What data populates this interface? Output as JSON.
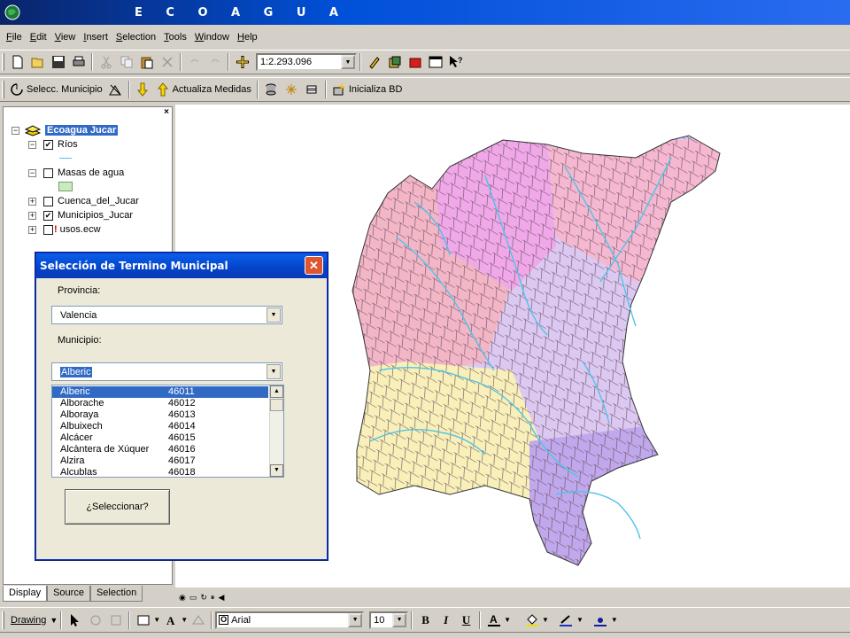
{
  "app": {
    "title": "E C O A G U A"
  },
  "menu": [
    "File",
    "Edit",
    "View",
    "Insert",
    "Selection",
    "Tools",
    "Window",
    "Help"
  ],
  "toolbar": {
    "scale": "1:2.293.096"
  },
  "toolbar2": {
    "select_municipio": "Selecc. Municipio",
    "actualiza_medidas": "Actualiza Medidas",
    "inicializa_bd": "Inicializa BD"
  },
  "toc": {
    "root": "Ecoagua Jucar",
    "layers": [
      {
        "name": "Ríos",
        "checked": true,
        "expanded": true
      },
      {
        "name": "Masas de agua",
        "checked": false,
        "expanded": true
      },
      {
        "name": "Cuenca_del_Jucar",
        "checked": false,
        "expanded": false
      },
      {
        "name": "Municipios_Jucar",
        "checked": true,
        "expanded": false
      },
      {
        "name": "usos.ecw",
        "checked": false,
        "expanded": false,
        "warning": "!"
      }
    ],
    "tabs": [
      "Display",
      "Source",
      "Selection"
    ]
  },
  "dialog": {
    "title": "Selección de Termino Municipal",
    "provincia_label": "Provincia:",
    "provincia_value": "Valencia",
    "municipio_label": "Municipio:",
    "municipio_value": "Alberic",
    "list": [
      {
        "name": "Alberic",
        "code": "46011",
        "selected": true
      },
      {
        "name": "Alborache",
        "code": "46012"
      },
      {
        "name": "Alboraya",
        "code": "46013"
      },
      {
        "name": "Albuixech",
        "code": "46014"
      },
      {
        "name": "Alcácer",
        "code": "46015"
      },
      {
        "name": "Alcàntera de Xúquer",
        "code": "46016"
      },
      {
        "name": "Alzira",
        "code": "46017"
      },
      {
        "name": "Alcublas",
        "code": "46018"
      }
    ],
    "button": "¿Seleccionar?"
  },
  "drawing": {
    "label": "Drawing",
    "font": "Arial",
    "size": "10"
  },
  "colors": {
    "titlebar": "#0050d8",
    "selection": "#316ac5",
    "river": "#4fc3e8",
    "zone_pink": "#f3b6c6",
    "zone_magenta": "#f0a8e8",
    "zone_lavender": "#dcc9f2",
    "zone_yellow": "#f8f0b8",
    "zone_purple": "#c0a8ec"
  }
}
